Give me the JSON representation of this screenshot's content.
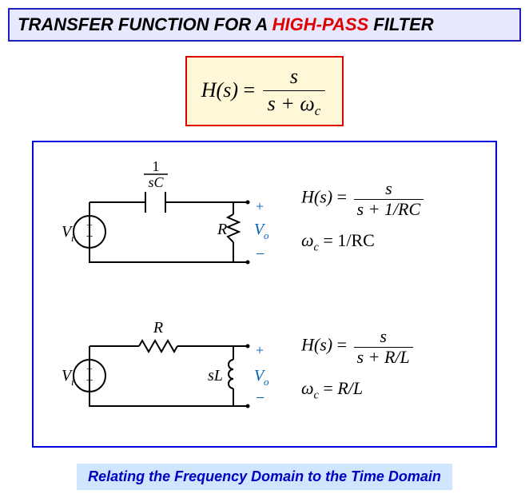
{
  "title": {
    "pre": "TRANSFER FUNCTION FOR A ",
    "highlight": "HIGH-PASS",
    "post": " FILTER"
  },
  "main_formula": {
    "lhs": "H(s)",
    "eq": " = ",
    "num": "s",
    "den_left": "s + ",
    "den_omega": "ω",
    "den_sub": "c"
  },
  "circuit1": {
    "top_label_num": "1",
    "top_label_den": "sC",
    "source_label": "V",
    "source_sub": "i",
    "source_plus": "+",
    "source_minus": "−",
    "load_label": "R",
    "out_label": "V",
    "out_sub": "o",
    "out_plus": "+",
    "out_minus": "−",
    "tf_lhs": "H(s)",
    "tf_eq": " = ",
    "tf_num": "s",
    "tf_den": "s + 1/RC",
    "wc_lhs_omega": "ω",
    "wc_lhs_sub": "c",
    "wc_eq": " = ",
    "wc_rhs": "1/RC"
  },
  "circuit2": {
    "top_label": "R",
    "source_label": "V",
    "source_sub": "i",
    "source_plus": "+",
    "source_minus": "−",
    "load_label": "sL",
    "out_label": "V",
    "out_sub": "o",
    "out_plus": "+",
    "out_minus": "−",
    "tf_lhs": "H(s)",
    "tf_eq": " = ",
    "tf_num": "s",
    "tf_den": "s + R/L",
    "wc_lhs_omega": "ω",
    "wc_lhs_sub": "c",
    "wc_eq": " = ",
    "wc_rhs": "R/L"
  },
  "footer": "Relating the Frequency Domain to the Time Domain"
}
